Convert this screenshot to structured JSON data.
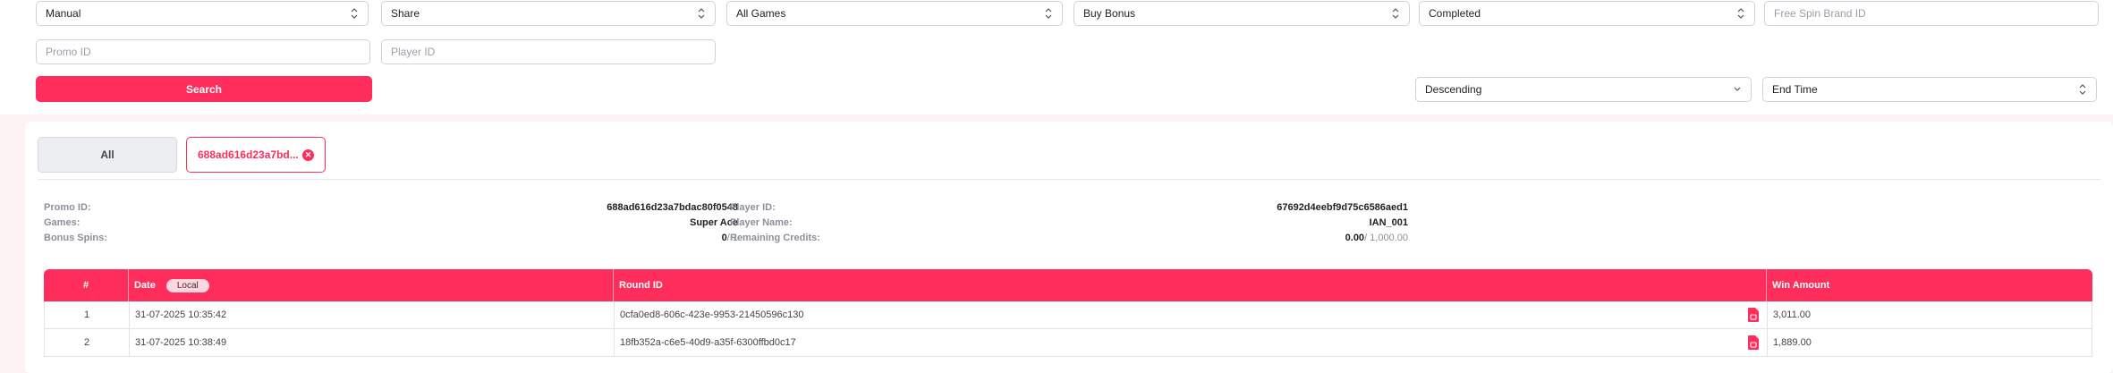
{
  "filters": {
    "row1": [
      {
        "value": "Manual",
        "placeholder": false,
        "type": "select"
      },
      {
        "value": "Share",
        "placeholder": false,
        "type": "select"
      },
      {
        "value": "All Games",
        "placeholder": false,
        "type": "select"
      },
      {
        "value": "Buy Bonus",
        "placeholder": false,
        "type": "select"
      },
      {
        "value": "Completed",
        "placeholder": false,
        "type": "select"
      },
      {
        "value": "Free Spin Brand ID",
        "placeholder": true,
        "type": "input"
      }
    ],
    "promo_id_placeholder": "Promo ID",
    "player_id_placeholder": "Player ID",
    "search_label": "Search",
    "sort_order": "Descending",
    "sort_field": "End Time"
  },
  "tabs": {
    "all_label": "All",
    "active_label": "688ad616d23a7bd..."
  },
  "details": {
    "promo_id_label": "Promo ID:",
    "promo_id_value": "688ad616d23a7bdac80f0548",
    "games_label": "Games:",
    "games_value": "Super Ace",
    "bonus_spins_label": "Bonus Spins:",
    "bonus_spins_used": "0",
    "bonus_spins_total": "/ 1",
    "player_id_label": "Player ID:",
    "player_id_value": "67692d4eebf9d75c6586aed1",
    "player_name_label": "Player Name:",
    "player_name_value": "IAN_001",
    "remaining_credits_label": "Remaining Credits:",
    "remaining_credits_used": "0.00",
    "remaining_credits_total": "/ 1,000.00"
  },
  "table": {
    "headers": {
      "index": "#",
      "date": "Date",
      "local": "Local",
      "round_id": "Round ID",
      "win_amount": "Win Amount"
    },
    "rows": [
      {
        "index": "1",
        "date": "31-07-2025 10:35:42",
        "round_id": "0cfa0ed8-606c-423e-9953-21450596c130",
        "win_amount": "3,011.00"
      },
      {
        "index": "2",
        "date": "31-07-2025 10:38:49",
        "round_id": "18fb352a-c6e5-40d9-a35f-6300ffbd0c17",
        "win_amount": "1,889.00"
      }
    ]
  },
  "colors": {
    "accent": "#ff2d5b",
    "background": "#fdf3f5"
  },
  "icons": [
    "chevron-updown-icon",
    "chevron-down-icon",
    "close-circle-icon",
    "document-icon"
  ]
}
